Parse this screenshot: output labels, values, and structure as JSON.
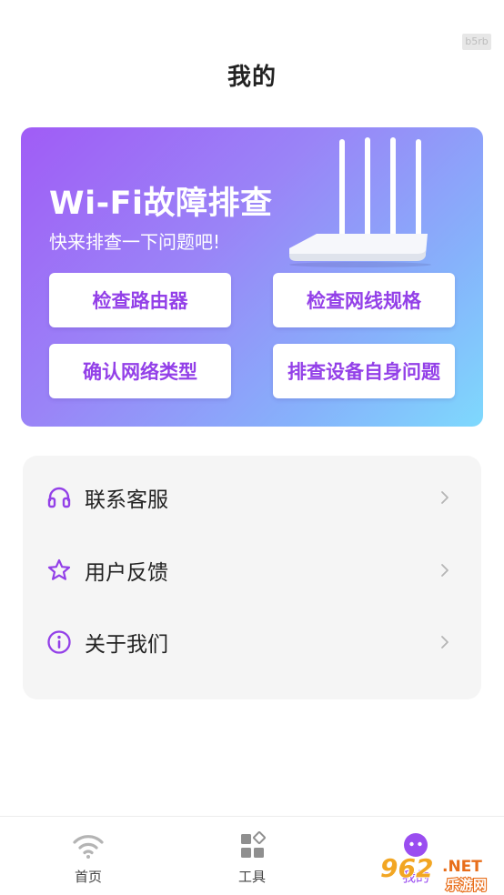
{
  "status": {
    "corner_badge": "b5rb"
  },
  "header": {
    "title": "我的"
  },
  "banner": {
    "title": "Wi-Fi故障排查",
    "subtitle": "快来排查一下问题吧!",
    "buttons": [
      "检查路由器",
      "检查网线规格",
      "确认网络类型",
      "排查设备自身问题"
    ]
  },
  "menu": {
    "items": [
      {
        "label": "联系客服",
        "icon": "headphones-icon"
      },
      {
        "label": "用户反馈",
        "icon": "star-icon"
      },
      {
        "label": "关于我们",
        "icon": "info-icon"
      }
    ]
  },
  "tabbar": {
    "tabs": [
      {
        "label": "首页",
        "icon": "wifi-icon",
        "active": false
      },
      {
        "label": "工具",
        "icon": "tools-grid-icon",
        "active": false
      },
      {
        "label": "我的",
        "icon": "profile-face-icon",
        "active": true
      }
    ]
  },
  "watermark": {
    "number": "962",
    "suffix": ".NET",
    "text": "乐游网"
  },
  "colors": {
    "accent": "#9340e8",
    "banner_start": "#a05cf6",
    "banner_end": "#7ed9fd",
    "menu_bg": "#f5f5f5"
  }
}
